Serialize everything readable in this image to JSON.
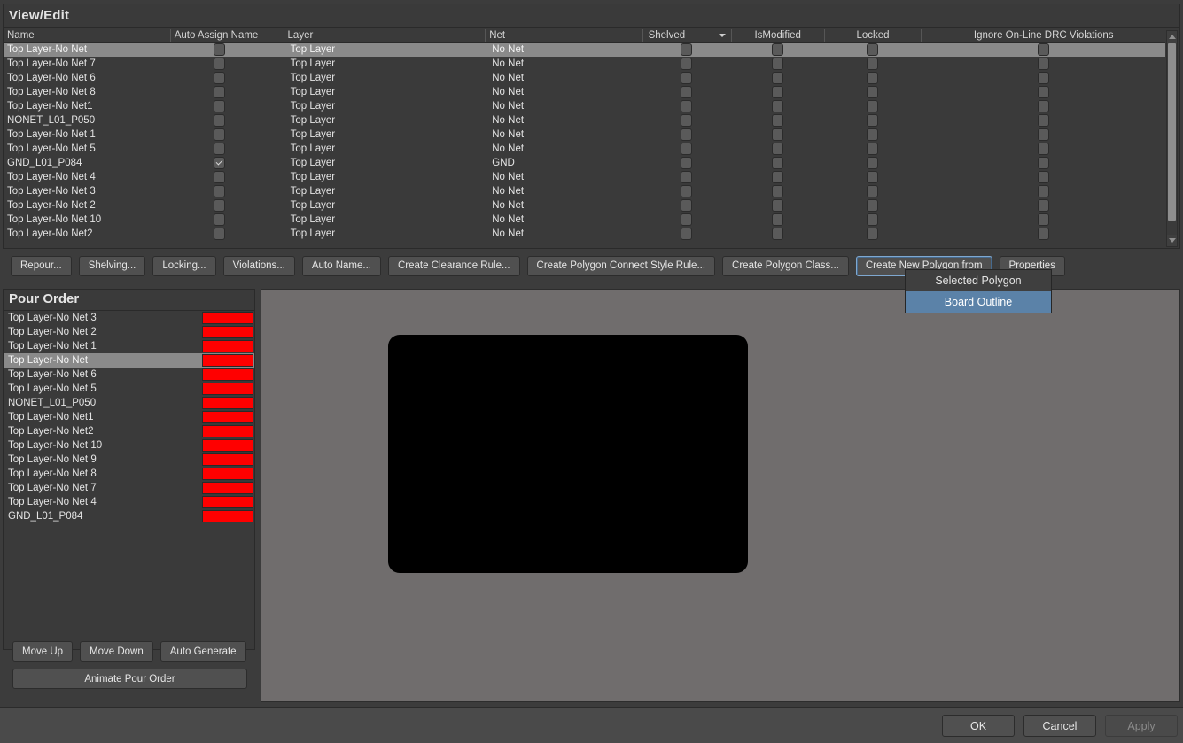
{
  "colors": {
    "accent_highlight": "#5b82a8",
    "row_selected": "#8a8a8a",
    "pour_swatch": "#ff0000",
    "preview_bg": "#706d6d",
    "board_fill": "#000000",
    "panel_bg": "#3a3a3a",
    "dialog_bg": "#3c3c3c"
  },
  "view_edit": {
    "title": "View/Edit",
    "columns": [
      {
        "label": "Name",
        "key": "name"
      },
      {
        "label": "Auto Assign Name",
        "key": "auto_assign_name"
      },
      {
        "label": "Layer",
        "key": "layer"
      },
      {
        "label": "Net",
        "key": "net"
      },
      {
        "label": "Shelved",
        "key": "shelved",
        "has_sort_arrow": true
      },
      {
        "label": "IsModified",
        "key": "is_modified"
      },
      {
        "label": "Locked",
        "key": "locked"
      },
      {
        "label": "Ignore On-Line DRC Violations",
        "key": "ignore_drc"
      }
    ],
    "rows": [
      {
        "name": "Top Layer-No Net",
        "auto_assign_name": false,
        "layer": "Top Layer",
        "net": "No Net",
        "shelved": false,
        "is_modified": false,
        "locked": false,
        "ignore_drc": false,
        "selected": true
      },
      {
        "name": "Top Layer-No Net 7",
        "auto_assign_name": false,
        "layer": "Top Layer",
        "net": "No Net",
        "shelved": false,
        "is_modified": false,
        "locked": false,
        "ignore_drc": false,
        "selected": false
      },
      {
        "name": "Top Layer-No Net 6",
        "auto_assign_name": false,
        "layer": "Top Layer",
        "net": "No Net",
        "shelved": false,
        "is_modified": false,
        "locked": false,
        "ignore_drc": false,
        "selected": false
      },
      {
        "name": "Top Layer-No Net 8",
        "auto_assign_name": false,
        "layer": "Top Layer",
        "net": "No Net",
        "shelved": false,
        "is_modified": false,
        "locked": false,
        "ignore_drc": false,
        "selected": false
      },
      {
        "name": "Top Layer-No Net1",
        "auto_assign_name": false,
        "layer": "Top Layer",
        "net": "No Net",
        "shelved": false,
        "is_modified": false,
        "locked": false,
        "ignore_drc": false,
        "selected": false
      },
      {
        "name": "NONET_L01_P050",
        "auto_assign_name": false,
        "layer": "Top Layer",
        "net": "No Net",
        "shelved": false,
        "is_modified": false,
        "locked": false,
        "ignore_drc": false,
        "selected": false
      },
      {
        "name": "Top Layer-No Net 1",
        "auto_assign_name": false,
        "layer": "Top Layer",
        "net": "No Net",
        "shelved": false,
        "is_modified": false,
        "locked": false,
        "ignore_drc": false,
        "selected": false
      },
      {
        "name": "Top Layer-No Net 5",
        "auto_assign_name": false,
        "layer": "Top Layer",
        "net": "No Net",
        "shelved": false,
        "is_modified": false,
        "locked": false,
        "ignore_drc": false,
        "selected": false
      },
      {
        "name": "GND_L01_P084",
        "auto_assign_name": true,
        "layer": "Top Layer",
        "net": "GND",
        "shelved": false,
        "is_modified": false,
        "locked": false,
        "ignore_drc": false,
        "selected": false
      },
      {
        "name": "Top Layer-No Net 4",
        "auto_assign_name": false,
        "layer": "Top Layer",
        "net": "No Net",
        "shelved": false,
        "is_modified": false,
        "locked": false,
        "ignore_drc": false,
        "selected": false
      },
      {
        "name": "Top Layer-No Net 3",
        "auto_assign_name": false,
        "layer": "Top Layer",
        "net": "No Net",
        "shelved": false,
        "is_modified": false,
        "locked": false,
        "ignore_drc": false,
        "selected": false
      },
      {
        "name": "Top Layer-No Net 2",
        "auto_assign_name": false,
        "layer": "Top Layer",
        "net": "No Net",
        "shelved": false,
        "is_modified": false,
        "locked": false,
        "ignore_drc": false,
        "selected": false
      },
      {
        "name": "Top Layer-No Net 10",
        "auto_assign_name": false,
        "layer": "Top Layer",
        "net": "No Net",
        "shelved": false,
        "is_modified": false,
        "locked": false,
        "ignore_drc": false,
        "selected": false
      },
      {
        "name": "Top Layer-No Net2",
        "auto_assign_name": false,
        "layer": "Top Layer",
        "net": "No Net",
        "shelved": false,
        "is_modified": false,
        "locked": false,
        "ignore_drc": false,
        "selected": false
      }
    ]
  },
  "action_buttons": [
    {
      "label": "Repour...",
      "focused": false
    },
    {
      "label": "Shelving...",
      "focused": false
    },
    {
      "label": "Locking...",
      "focused": false
    },
    {
      "label": "Violations...",
      "focused": false
    },
    {
      "label": "Auto Name...",
      "focused": false
    },
    {
      "label": "Create Clearance Rule...",
      "focused": false
    },
    {
      "label": "Create Polygon Connect Style Rule...",
      "focused": false
    },
    {
      "label": "Create Polygon Class...",
      "focused": false
    },
    {
      "label": "Create New Polygon from",
      "focused": true
    },
    {
      "label": "Properties",
      "focused": false
    }
  ],
  "dropdown_menu": {
    "open": true,
    "items": [
      {
        "label": "Selected Polygon",
        "highlighted": false
      },
      {
        "label": "Board Outline",
        "highlighted": true
      }
    ]
  },
  "pour_order": {
    "title": "Pour Order",
    "items": [
      {
        "name": "Top Layer-No Net 3",
        "color": "#ff0000",
        "selected": false
      },
      {
        "name": "Top Layer-No Net 2",
        "color": "#ff0000",
        "selected": false
      },
      {
        "name": "Top Layer-No Net 1",
        "color": "#ff0000",
        "selected": false
      },
      {
        "name": "Top Layer-No Net",
        "color": "#ff0000",
        "selected": true
      },
      {
        "name": "Top Layer-No Net 6",
        "color": "#ff0000",
        "selected": false
      },
      {
        "name": "Top Layer-No Net 5",
        "color": "#ff0000",
        "selected": false
      },
      {
        "name": "NONET_L01_P050",
        "color": "#ff0000",
        "selected": false
      },
      {
        "name": "Top Layer-No Net1",
        "color": "#ff0000",
        "selected": false
      },
      {
        "name": "Top Layer-No Net2",
        "color": "#ff0000",
        "selected": false
      },
      {
        "name": "Top Layer-No Net 10",
        "color": "#ff0000",
        "selected": false
      },
      {
        "name": "Top Layer-No Net 9",
        "color": "#ff0000",
        "selected": false
      },
      {
        "name": "Top Layer-No Net 8",
        "color": "#ff0000",
        "selected": false
      },
      {
        "name": "Top Layer-No Net 7",
        "color": "#ff0000",
        "selected": false
      },
      {
        "name": "Top Layer-No Net 4",
        "color": "#ff0000",
        "selected": false
      },
      {
        "name": "GND_L01_P084",
        "color": "#ff0000",
        "selected": false
      }
    ],
    "buttons": [
      {
        "label": "Move Up"
      },
      {
        "label": "Move Down"
      },
      {
        "label": "Auto Generate"
      }
    ],
    "animate_button": "Animate Pour Order"
  },
  "footer": {
    "ok": "OK",
    "cancel": "Cancel",
    "apply": "Apply",
    "apply_disabled": true
  }
}
